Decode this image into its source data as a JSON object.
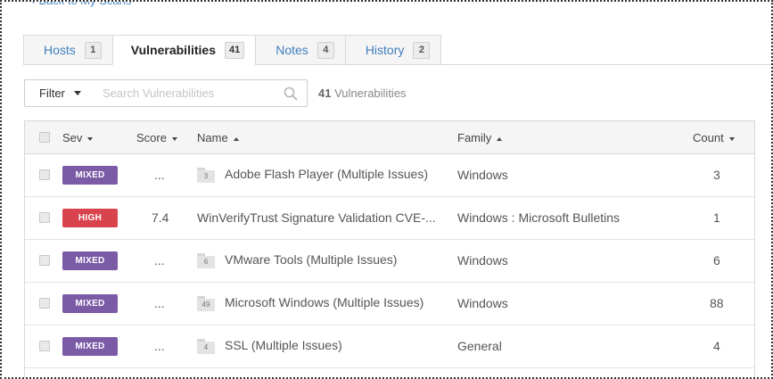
{
  "nav": {
    "back_label": "Back to My Scans"
  },
  "tabs": [
    {
      "label": "Hosts",
      "count": "1",
      "active": false
    },
    {
      "label": "Vulnerabilities",
      "count": "41",
      "active": true
    },
    {
      "label": "Notes",
      "count": "4",
      "active": false
    },
    {
      "label": "History",
      "count": "2",
      "active": false
    }
  ],
  "filter": {
    "button_label": "Filter",
    "search_placeholder": "Search Vulnerabilities",
    "search_value": "",
    "result_count": "41",
    "result_label": "Vulnerabilities"
  },
  "table": {
    "columns": {
      "sev": "Sev",
      "score": "Score",
      "name": "Name",
      "family": "Family",
      "count": "Count"
    },
    "rows": [
      {
        "sev": "MIXED",
        "score": "...",
        "group_count": "3",
        "name": "Adobe Flash Player (Multiple Issues)",
        "family": "Windows",
        "count": "3"
      },
      {
        "sev": "HIGH",
        "score": "7.4",
        "group_count": "",
        "name": "WinVerifyTrust Signature Validation CVE-...",
        "family": "Windows : Microsoft Bulletins",
        "count": "1"
      },
      {
        "sev": "MIXED",
        "score": "...",
        "group_count": "6",
        "name": "VMware Tools (Multiple Issues)",
        "family": "Windows",
        "count": "6"
      },
      {
        "sev": "MIXED",
        "score": "...",
        "group_count": "49",
        "name": "Microsoft Windows (Multiple Issues)",
        "family": "Windows",
        "count": "88"
      },
      {
        "sev": "MIXED",
        "score": "...",
        "group_count": "4",
        "name": "SSL (Multiple Issues)",
        "family": "General",
        "count": "4"
      }
    ]
  },
  "colors": {
    "mixed": "#7b5aa6",
    "high": "#d9434e",
    "link": "#3f7fbf"
  },
  "icons": {
    "search": "search-icon",
    "folder": "folder-icon",
    "caret": "caret-down-icon"
  }
}
